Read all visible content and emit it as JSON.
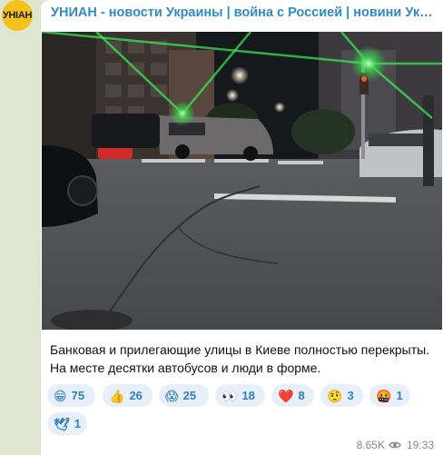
{
  "channel": {
    "avatar_text": "УНIАН",
    "name": "УНИАН - новости Украины | война с Россией | новини України | война"
  },
  "message": {
    "caption": "Банковая и прилегающие улицы в Киеве полностью перекрыты. На месте десятки автобусов и люди в форме.",
    "reactions": [
      {
        "emoji": "😁",
        "count": "75"
      },
      {
        "emoji": "👍",
        "count": "26"
      },
      {
        "emoji": "😱",
        "count": "25"
      },
      {
        "emoji": "👀",
        "count": "18"
      },
      {
        "emoji": "❤️",
        "count": "8"
      },
      {
        "emoji": "🤨",
        "count": "3"
      },
      {
        "emoji": "🤬",
        "count": "1"
      },
      {
        "emoji": "🕊",
        "count": "1"
      }
    ],
    "views": "8.65K",
    "time": "19:33"
  }
}
